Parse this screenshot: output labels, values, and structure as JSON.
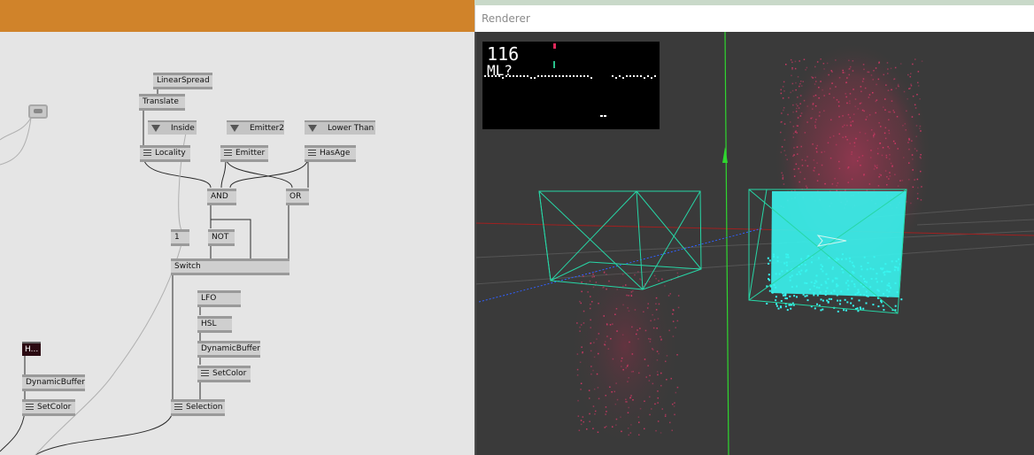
{
  "renderer": {
    "title": "Renderer"
  },
  "hud": {
    "fps": "116",
    "label": "ML?"
  },
  "nodes": {
    "linear_spread": "LinearSpread",
    "translate": "Translate",
    "inside": "Inside",
    "emitter2": "Emitter2",
    "lower_than": "Lower Than",
    "locality": "Locality",
    "emitter": "Emitter",
    "has_age": "HasAge",
    "and": "AND",
    "or": "OR",
    "one": "1",
    "not": "NOT",
    "switch": "Switch",
    "lfo": "LFO",
    "hsl": "HSL",
    "dynamic_buffer_right": "DynamicBuffer",
    "set_color_right": "SetColor",
    "selection": "Selection",
    "h_node": "H...",
    "dynamic_buffer_left": "DynamicBuffer",
    "set_color_left": "SetColor"
  },
  "colors": {
    "patch_title_bar": "#d0832a",
    "cyan_particles": "#38f5f0",
    "pink_particles": "#e0386a",
    "wireframe": "#27d6a6",
    "y_axis": "#2fd62f",
    "x_axis": "#b02020",
    "z_axis": "#3060ff"
  }
}
